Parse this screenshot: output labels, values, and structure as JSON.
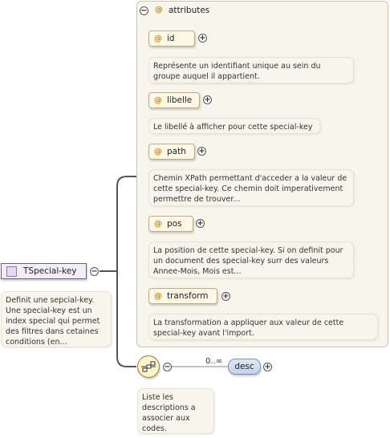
{
  "type_node": {
    "label": "TSpecial-key",
    "note": "Definit une sepcial-key. Une special-key est un index special qui permet des filtres dans cetaines conditions (en..."
  },
  "attributes_group": {
    "label": "attributes"
  },
  "attributes": [
    {
      "name": "id",
      "note": "Représente un identifiant unique au sein du groupe auquel il appartient."
    },
    {
      "name": "libelle",
      "note": "Le libellé à afficher pour cette special-key"
    },
    {
      "name": "path",
      "note": "Chemin XPath permettant d'acceder a la valeur de cette special-key. Ce chemin doit imperativement permettre de trouver..."
    },
    {
      "name": "pos",
      "note": "La position de cette special-key. Si on definit pour un document des special-key surr des valeurs Annee-Mois, Mois est..."
    },
    {
      "name": "transform",
      "note": "La transformation a appliquer aux valeur de cette special-key avant l'import."
    }
  ],
  "sequence": {
    "note": "Liste les descriptions a associer aux codes."
  },
  "child_element": {
    "label": "desc",
    "multiplicity": "0..∞"
  },
  "icons": {
    "attribute_marker": "@",
    "expand": "+",
    "collapse": "−",
    "type": "complex-type-icon",
    "sequence": "sequence-icon"
  }
}
